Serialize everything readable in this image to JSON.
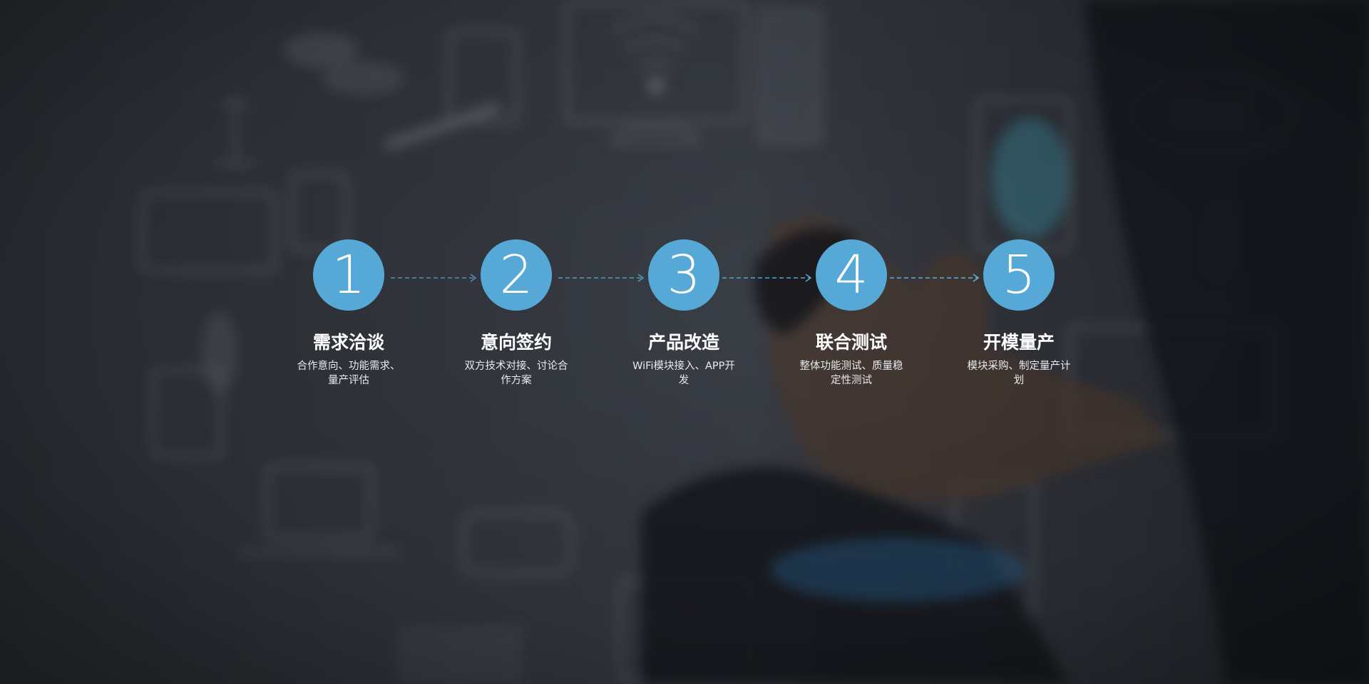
{
  "colors": {
    "accent": "#56a9d6",
    "connector": "#5aaedc",
    "title_text": "#ffffff",
    "desc_text": "#e8eaee"
  },
  "steps": [
    {
      "number": "1",
      "title": "需求洽谈",
      "description": "合作意向、功能需求、量产评估"
    },
    {
      "number": "2",
      "title": "意向签约",
      "description": "双方技术对接、讨论合作方案"
    },
    {
      "number": "3",
      "title": "产品改造",
      "description": "WiFi模块接入、APP开发"
    },
    {
      "number": "4",
      "title": "联合测试",
      "description": "整体功能测试、质量稳定性测试"
    },
    {
      "number": "5",
      "title": "开模量产",
      "description": "模块采购、制定量产计划"
    }
  ]
}
